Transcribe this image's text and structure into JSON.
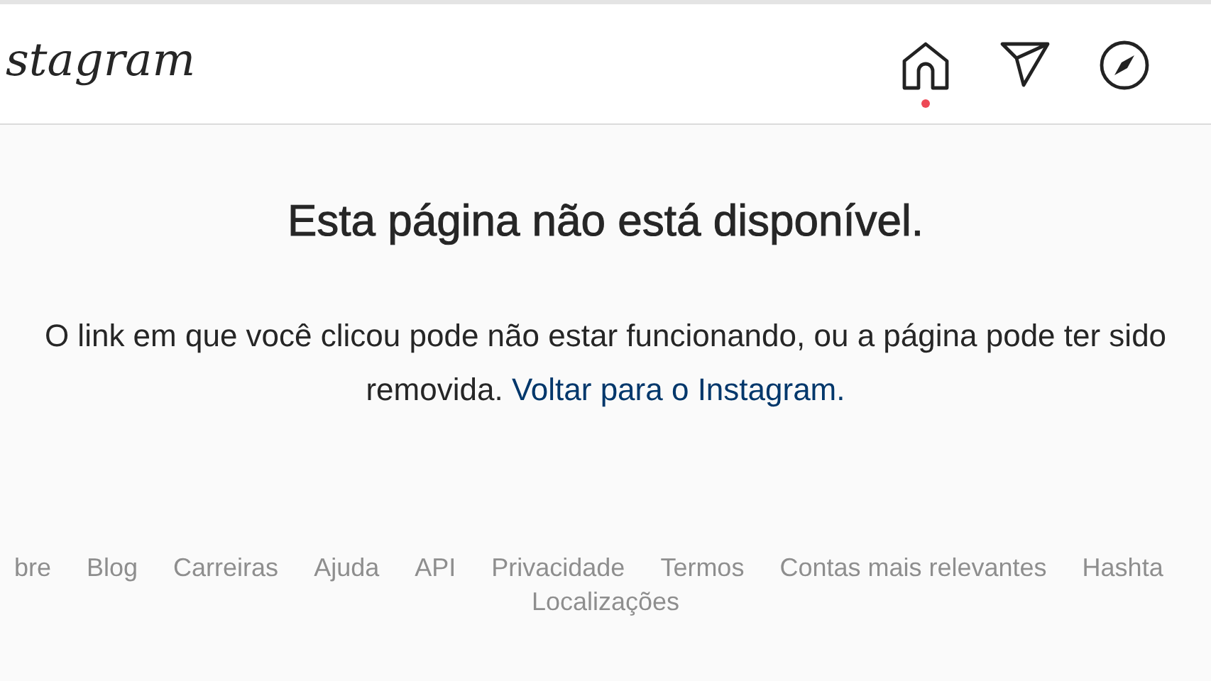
{
  "header": {
    "logo": "stagram",
    "nav": [
      {
        "kind": "home",
        "selected": true
      },
      {
        "kind": "direct",
        "selected": false
      },
      {
        "kind": "explore",
        "selected": false
      }
    ]
  },
  "error": {
    "title": "Esta página não está disponível.",
    "message": "O link em que você clicou pode não estar funcionando, ou a página pode ter sido removida.",
    "link": "Voltar para o Instagram."
  },
  "footer": {
    "links": [
      "bre",
      "Blog",
      "Carreiras",
      "Ajuda",
      "API",
      "Privacidade",
      "Termos",
      "Contas mais relevantes",
      "Hashta"
    ],
    "second_row": [
      "Localizações"
    ]
  }
}
